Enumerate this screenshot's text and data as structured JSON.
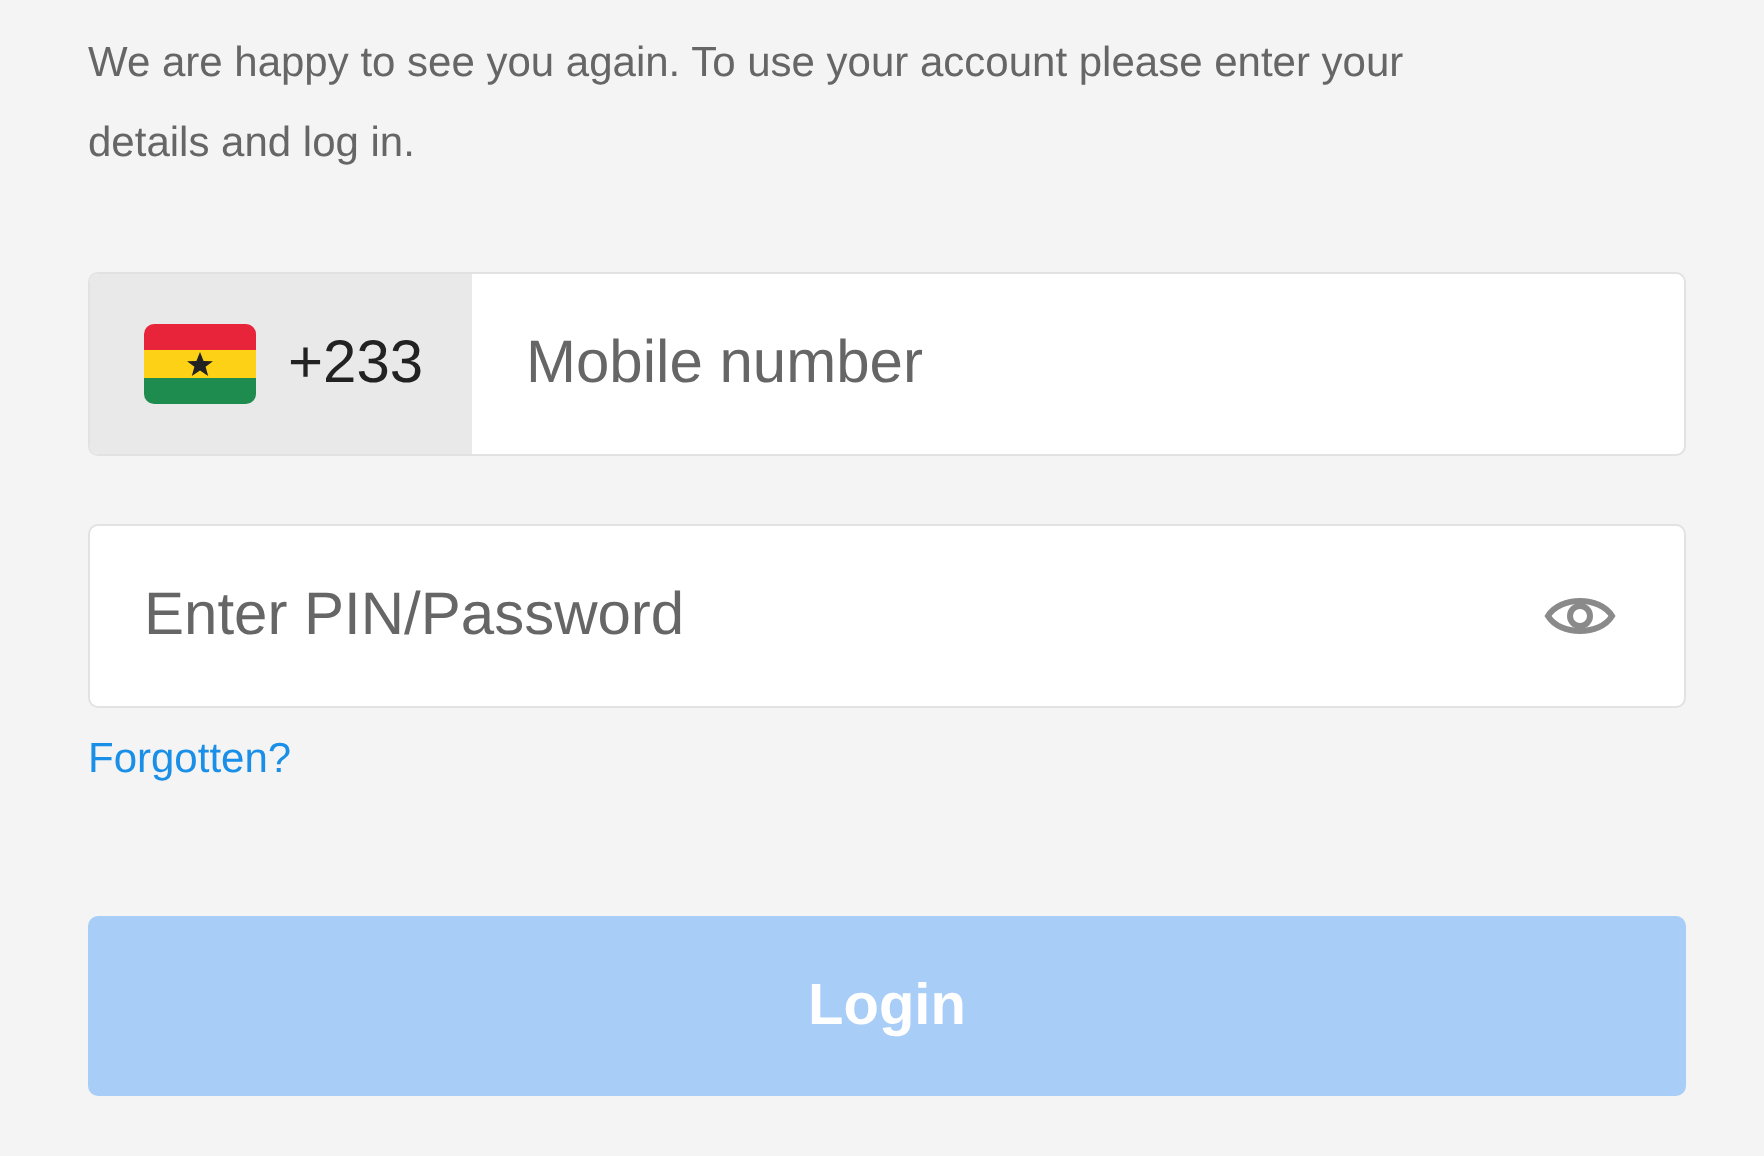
{
  "intro": "We are happy to see you again. To use your account please enter your details and log in.",
  "phone": {
    "country_code": "+233",
    "placeholder": "Mobile number"
  },
  "password": {
    "placeholder": "Enter PIN/Password"
  },
  "forgot_link": "Forgotten?",
  "login_button": {
    "label": "Login",
    "disabled": true
  }
}
